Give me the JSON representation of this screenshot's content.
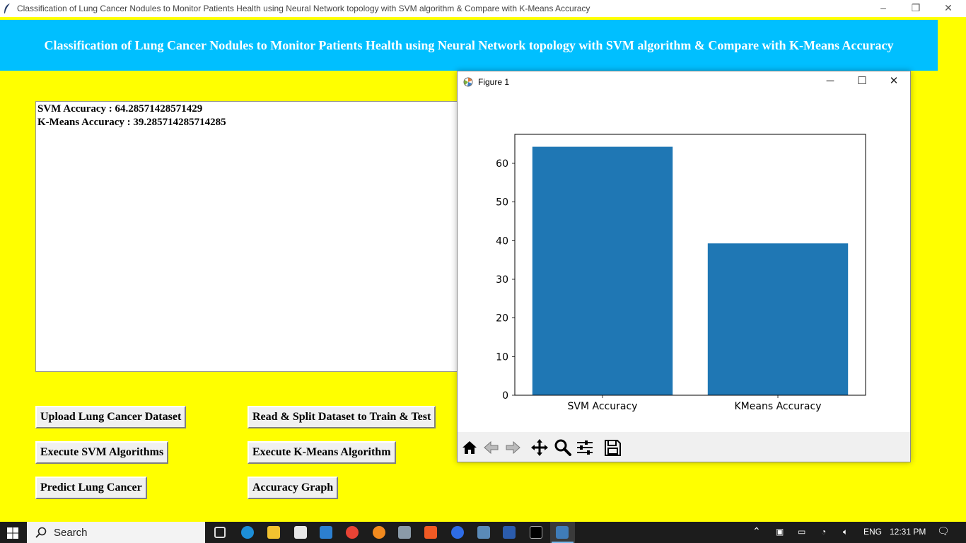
{
  "window": {
    "title": "Classification of Lung Cancer Nodules to Monitor Patients Health using Neural Network topology with SVM algorithm & Compare with K-Means Accuracy",
    "minimize": "–",
    "restore": "❐",
    "close": "✕"
  },
  "header": {
    "title": "Classification of Lung Cancer Nodules to Monitor Patients Health using Neural Network topology with SVM algorithm & Compare with K-Means Accuracy"
  },
  "output": {
    "lines": [
      "SVM Accuracy : 64.28571428571429",
      "K-Means Accuracy : 39.285714285714285"
    ]
  },
  "buttons": {
    "upload": "Upload Lung Cancer Dataset",
    "split": "Read & Split Dataset to Train & Test",
    "svm": "Execute SVM Algorithms",
    "kmeans": "Execute K-Means Algorithm",
    "predict": "Predict Lung Cancer",
    "graph": "Accuracy Graph"
  },
  "figure": {
    "title": "Figure 1",
    "minimize": "─",
    "maximize": "☐",
    "close": "✕"
  },
  "chart_data": {
    "type": "bar",
    "categories": [
      "SVM Accuracy",
      "KMeans Accuracy"
    ],
    "values": [
      64.28571428571429,
      39.285714285714285
    ],
    "yticks": [
      0,
      10,
      20,
      30,
      40,
      50,
      60
    ],
    "ylim": [
      0,
      67.5
    ],
    "bar_color": "#1f77b4",
    "title": "",
    "xlabel": "",
    "ylabel": ""
  },
  "taskbar": {
    "search_label": "Search",
    "language": "ENG",
    "time": "12:31 PM"
  },
  "colors": {
    "background": "#ffff00",
    "header": "#00bfff",
    "header_text": "#ffffff"
  }
}
